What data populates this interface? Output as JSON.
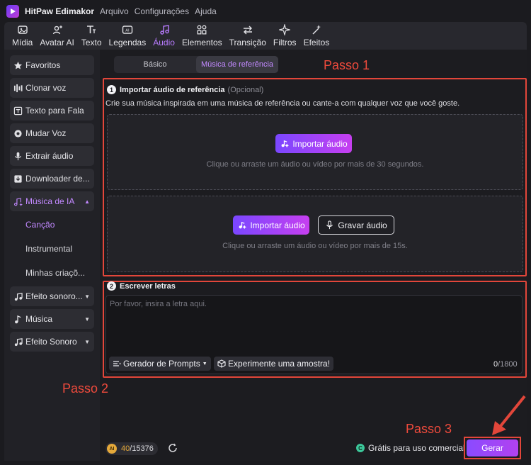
{
  "app": {
    "name": "HitPaw Edimakor",
    "menu": [
      "Arquivo",
      "Configurações",
      "Ajuda"
    ]
  },
  "toolbar": {
    "tabs": [
      {
        "label": "Mídia",
        "icon": "image-icon"
      },
      {
        "label": "Avatar AI",
        "icon": "avatar-icon"
      },
      {
        "label": "Legendas",
        "icon": "subtitles-icon"
      },
      {
        "label": "Texto",
        "icon": "text-icon"
      },
      {
        "label": "Áudio",
        "icon": "music-note-icon",
        "active": true
      },
      {
        "label": "Elementos",
        "icon": "elements-icon"
      },
      {
        "label": "Transição",
        "icon": "transition-icon"
      },
      {
        "label": "Filtros",
        "icon": "sparkle-icon"
      },
      {
        "label": "Efeitos",
        "icon": "wand-icon"
      }
    ]
  },
  "sidebar": {
    "items": [
      {
        "label": "Favoritos",
        "icon": "star-icon"
      },
      {
        "label": "Clonar voz",
        "icon": "clone-voice-icon"
      },
      {
        "label": "Texto para Fala",
        "icon": "text-to-speech-icon"
      },
      {
        "label": "Mudar Voz",
        "icon": "change-voice-icon"
      },
      {
        "label": "Extrair áudio",
        "icon": "microphone-icon"
      },
      {
        "label": "Downloader de...",
        "icon": "download-icon"
      },
      {
        "label": "Música de IA",
        "icon": "ai-music-icon",
        "active": true,
        "expanded": true
      }
    ],
    "subitems": [
      {
        "label": "Canção",
        "active": true
      },
      {
        "label": "Instrumental"
      },
      {
        "label": "Minhas criaçõ..."
      }
    ],
    "items2": [
      {
        "label": "Efeito sonoro...",
        "icon": "sound-effect-icon"
      },
      {
        "label": "Música",
        "icon": "music-icon"
      },
      {
        "label": "Efeito Sonoro",
        "icon": "sound-effect-icon"
      }
    ]
  },
  "main": {
    "mode_tabs": [
      {
        "label": "Básico"
      },
      {
        "label": "Música de referência",
        "active": true
      }
    ],
    "steps": [
      "Passo 1",
      "Passo 2",
      "Passo 3"
    ],
    "section1": {
      "number": "1",
      "title": "Importar áudio de referência",
      "optional": "(Opcional)",
      "description": "Crie sua música inspirada em uma música de referência ou cante-a com qualquer voz que você goste.",
      "drop1": {
        "button": "Importar áudio",
        "hint": "Clique ou arraste um áudio ou vídeo por mais de 30 segundos."
      },
      "drop2": {
        "import_button": "Importar áudio",
        "record_button": "Gravar áudio",
        "hint": "Clique ou arraste um áudio ou vídeo por mais de 15s."
      }
    },
    "section2": {
      "number": "2",
      "title": "Escrever letras",
      "placeholder": "Por favor, insira a letra aqui.",
      "prompt_generator": "Gerador de Prompts",
      "try_sample": "Experimente uma amostra!",
      "counter_current": "0",
      "counter_max": "/1800"
    },
    "bottom": {
      "credits_used": "40",
      "credits_total": "/15376",
      "free_commercial": "Grátis para uso comercial",
      "generate": "Gerar"
    }
  },
  "colors": {
    "accent": "#c289ff",
    "annotation": "#e2463a",
    "gradient_start": "#7a47ff",
    "gradient_end": "#c63ff0"
  }
}
